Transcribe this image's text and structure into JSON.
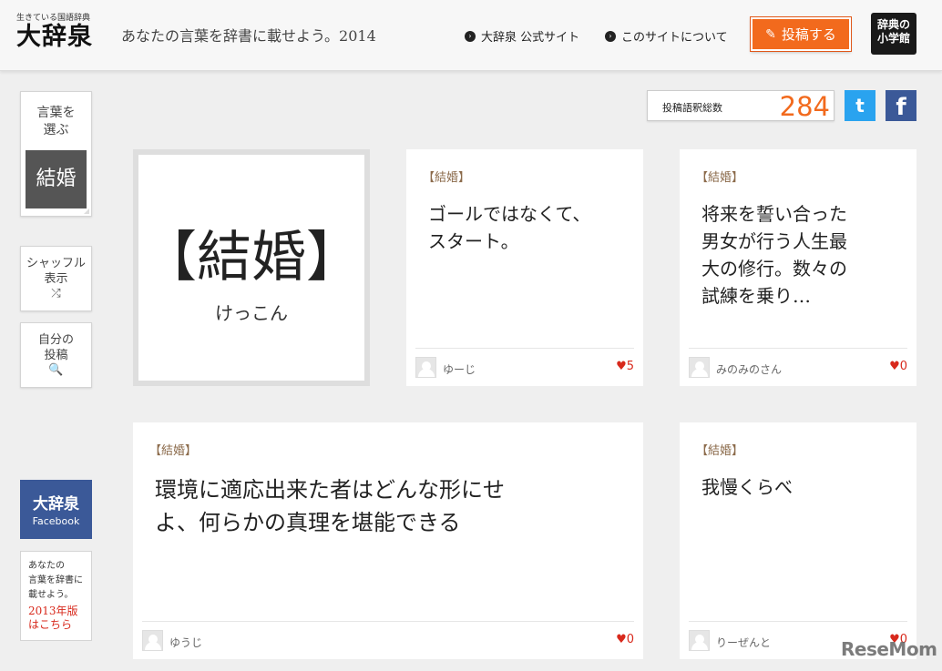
{
  "header": {
    "logo_sub": "生きている国語辞典",
    "logo_main": "大辞泉",
    "tagline": "あなたの言葉を辞書に載せよう。2014",
    "nav": [
      {
        "label": "大辞泉 公式サイト"
      },
      {
        "label": "このサイトについて"
      }
    ],
    "post_label": "投稿する",
    "shogakukan": [
      "辞典の",
      "小学館"
    ]
  },
  "sidebar": {
    "choose_label_1": "言葉を",
    "choose_label_2": "選ぶ",
    "choose_word": "結婚",
    "shuffle_1": "シャッフル",
    "shuffle_2": "表示",
    "shuffle_icon": "⤮",
    "mine_1": "自分の",
    "mine_2": "投稿",
    "mine_icon": "🔍",
    "fb_title": "大辞泉",
    "fb_sub": "Facebook",
    "promo": [
      "あなたの",
      "言葉を辞書に",
      "載せよう。"
    ],
    "promo_red": [
      "2013年版",
      "はこちら"
    ]
  },
  "counter": {
    "label": "投稿語釈総数",
    "value": "284"
  },
  "social": {
    "twitter": "t",
    "facebook": "f"
  },
  "word": {
    "headword": "【結婚】",
    "reading": "けっこん"
  },
  "posts": [
    {
      "tag": "【結婚】",
      "lines": [
        "ゴールではなくて、",
        "スタート。"
      ],
      "user": "ゆーじ",
      "likes": "5"
    },
    {
      "tag": "【結婚】",
      "lines": [
        "将来を誓い合った",
        "男女が行う人生最",
        "大の修行。数々の",
        "試練を乗り…"
      ],
      "user": "みのみのさん",
      "likes": "0"
    },
    {
      "tag": "【結婚】",
      "lines": [
        "環境に適応出来た者はどんな形にせ",
        "よ、何らかの真理を堪能できる"
      ],
      "user": "ゆうじ",
      "likes": "0"
    },
    {
      "tag": "【結婚】",
      "lines": [
        "我慢くらべ"
      ],
      "user": "りーぜんと",
      "likes": "0"
    }
  ],
  "heart": "♥",
  "watermark": "ReseMom"
}
